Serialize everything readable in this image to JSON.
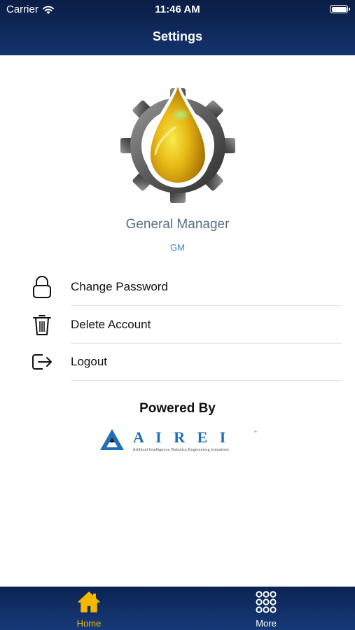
{
  "status_bar": {
    "carrier": "Carrier",
    "time": "11:46 AM"
  },
  "header": {
    "title": "Settings"
  },
  "profile": {
    "name": "General Manager",
    "role": "GM",
    "logo_icon": "oil-drop-gear-logo"
  },
  "menu": [
    {
      "label": "Change Password",
      "icon": "lock-icon"
    },
    {
      "label": "Delete Account",
      "icon": "trash-icon"
    },
    {
      "label": "Logout",
      "icon": "logout-icon"
    }
  ],
  "footer": {
    "powered_by": "Powered By",
    "brand_name": "A I R E I",
    "brand_tagline": "Artificial Intelligence Robotics Engineering Industries"
  },
  "tabbar": {
    "active_color": "#f5b800",
    "tabs": [
      {
        "label": "Home",
        "icon": "home-icon",
        "active": true
      },
      {
        "label": "More",
        "icon": "grid-icon",
        "active": false
      }
    ]
  }
}
